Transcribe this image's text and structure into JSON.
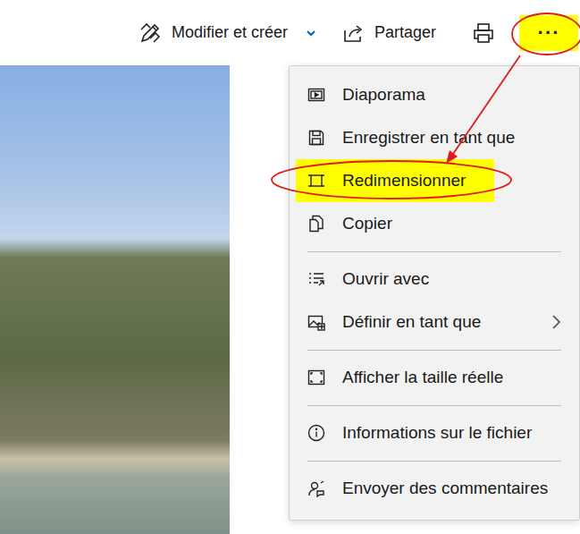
{
  "toolbar": {
    "edit": {
      "label": "Modifier et créer",
      "dropdown": true
    },
    "share": {
      "label": "Partager"
    },
    "more": {
      "label": "···",
      "highlighted": true
    }
  },
  "menu": {
    "items": [
      {
        "label": "Diaporama",
        "highlighted": false,
        "submenu": false,
        "separator_after": false
      },
      {
        "label": "Enregistrer en tant que",
        "highlighted": false,
        "submenu": false,
        "separator_after": false
      },
      {
        "label": "Redimensionner",
        "highlighted": true,
        "submenu": false,
        "separator_after": false
      },
      {
        "label": "Copier",
        "highlighted": false,
        "submenu": false,
        "separator_after": true
      },
      {
        "label": "Ouvrir avec",
        "highlighted": false,
        "submenu": false,
        "separator_after": false
      },
      {
        "label": "Définir en tant que",
        "highlighted": false,
        "submenu": true,
        "separator_after": true
      },
      {
        "label": "Afficher la taille réelle",
        "highlighted": false,
        "submenu": false,
        "separator_after": true
      },
      {
        "label": "Informations sur le fichier",
        "highlighted": false,
        "submenu": false,
        "separator_after": true
      },
      {
        "label": "Envoyer des commentaires",
        "highlighted": false,
        "submenu": false,
        "separator_after": false
      }
    ]
  }
}
